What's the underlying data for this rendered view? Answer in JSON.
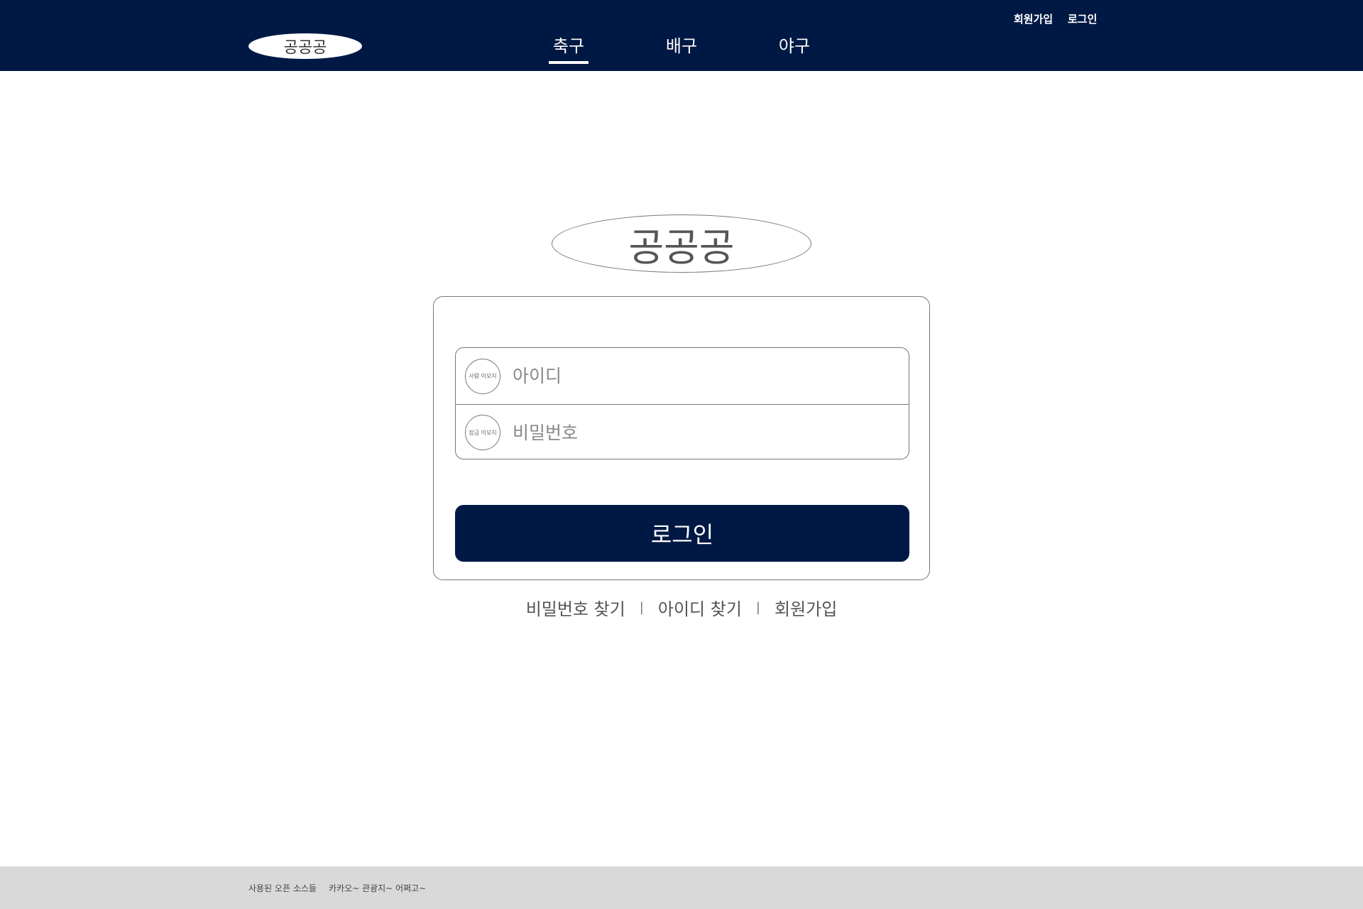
{
  "header": {
    "logo": "공공공",
    "nav": [
      {
        "label": "축구",
        "active": true
      },
      {
        "label": "배구",
        "active": false
      },
      {
        "label": "야구",
        "active": false
      }
    ],
    "signup_link": "회원가입",
    "login_link": "로그인"
  },
  "main": {
    "logo": "공공공",
    "id_field": {
      "icon_label": "사람 이모지",
      "placeholder": "아이디",
      "value": ""
    },
    "pw_field": {
      "icon_label": "잠금 이모지",
      "placeholder": "비밀번호",
      "value": ""
    },
    "login_button": "로그인",
    "links": {
      "find_password": "비밀번호 찾기",
      "separator": "|",
      "find_id": "아이디 찾기",
      "signup": "회원가입"
    }
  },
  "footer": {
    "sources_label": "사용된 오픈 소스들",
    "sources_list": "카카오~ 관광지~ 어쩌고~"
  },
  "colors": {
    "navy": "#001944",
    "footer_bg": "#d9d9d9"
  }
}
